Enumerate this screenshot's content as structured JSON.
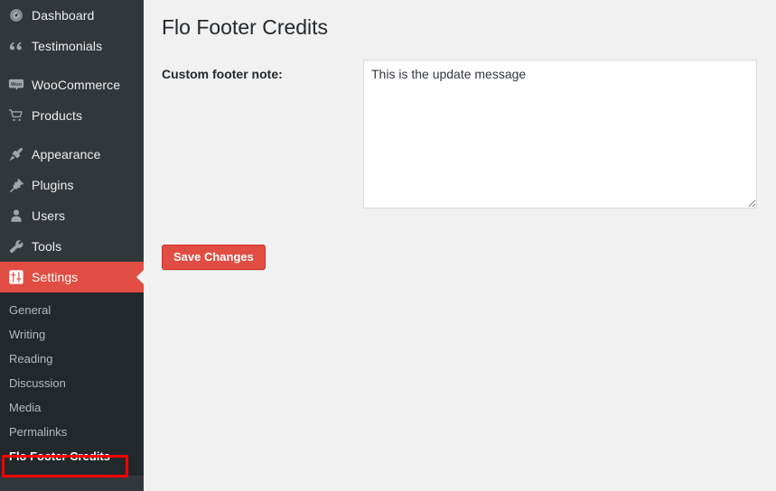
{
  "sidebar": {
    "menu": [
      {
        "label": "Dashboard",
        "icon": "dashboard-gauge-icon",
        "name": "dashboard"
      },
      {
        "label": "Testimonials",
        "icon": "quote-icon",
        "name": "testimonials"
      },
      {
        "label": "WooCommerce",
        "icon": "woocommerce-bubble-icon",
        "name": "woocommerce"
      },
      {
        "label": "Products",
        "icon": "shopping-cart-icon",
        "name": "products"
      },
      {
        "label": "Appearance",
        "icon": "paintbrush-icon",
        "name": "appearance"
      },
      {
        "label": "Plugins",
        "icon": "plug-icon",
        "name": "plugins"
      },
      {
        "label": "Users",
        "icon": "user-icon",
        "name": "users"
      },
      {
        "label": "Tools",
        "icon": "wrench-icon",
        "name": "tools"
      },
      {
        "label": "Settings",
        "icon": "settings-sliders-icon",
        "name": "settings",
        "current": true
      }
    ],
    "submenu": [
      {
        "label": "General",
        "name": "general"
      },
      {
        "label": "Writing",
        "name": "writing"
      },
      {
        "label": "Reading",
        "name": "reading"
      },
      {
        "label": "Discussion",
        "name": "discussion"
      },
      {
        "label": "Media",
        "name": "media"
      },
      {
        "label": "Permalinks",
        "name": "permalinks"
      },
      {
        "label": "Flo Footer Credits",
        "name": "flo-footer-credits",
        "current": true
      }
    ],
    "colors": {
      "background": "#32373c",
      "submenu_background": "#23282d",
      "active": "#e14d43",
      "text": "#eeeeee",
      "submenu_text": "#b4b9be"
    }
  },
  "main": {
    "page_title": "Flo Footer Credits",
    "field_label": "Custom footer note:",
    "textarea_value": "This is the update message",
    "textarea_placeholder": "",
    "save_button_label": "Save Changes",
    "colors": {
      "background": "#f1f1f1",
      "button": "#e14d43",
      "title_text": "#23282d"
    }
  },
  "annotation": {
    "color": "#ff0000",
    "target": "Flo Footer Credits"
  }
}
